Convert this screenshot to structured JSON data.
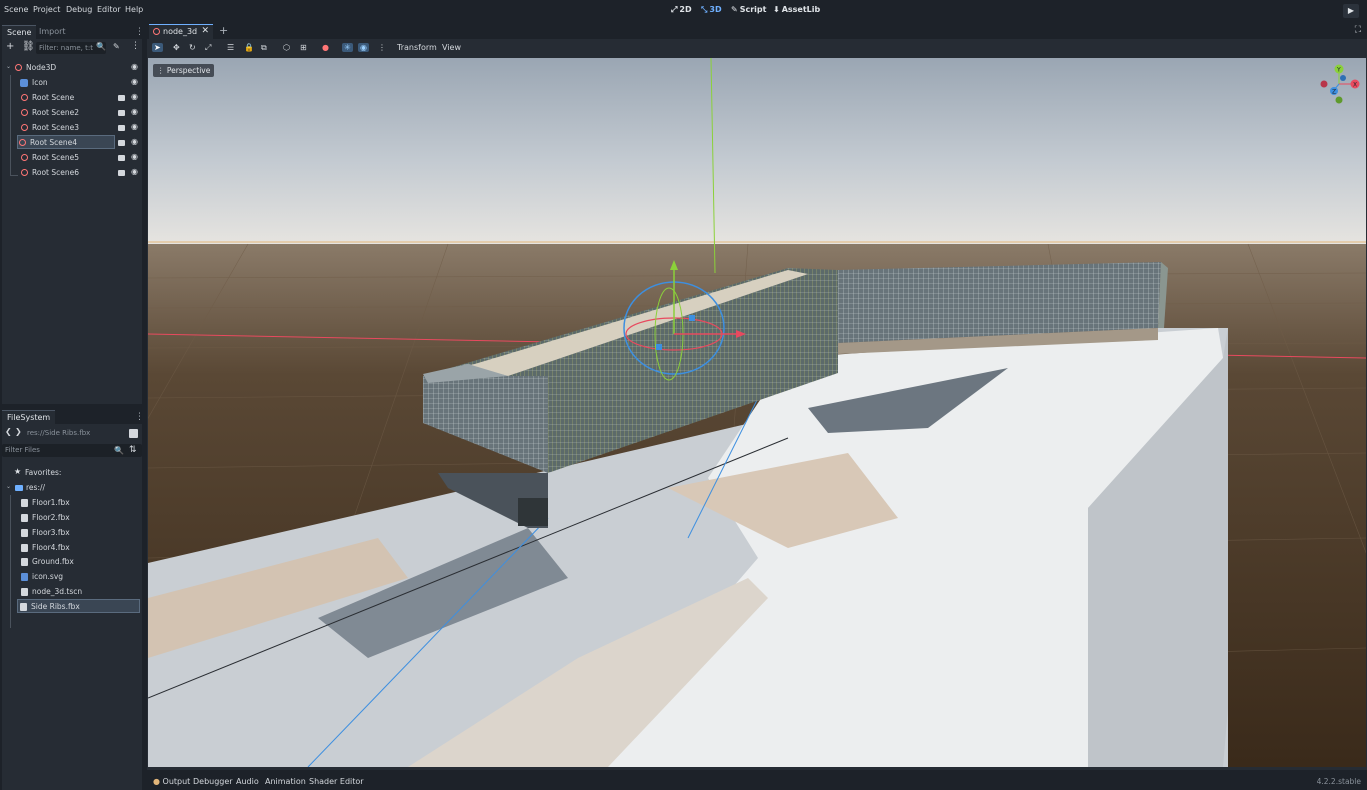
{
  "menu": [
    "Scene",
    "Project",
    "Debug",
    "Editor",
    "Help"
  ],
  "workspaces": [
    {
      "label": "2D",
      "icon": "⤢"
    },
    {
      "label": "3D",
      "icon": "⤡"
    },
    {
      "label": "Script",
      "icon": "✎"
    },
    {
      "label": "AssetLib",
      "icon": "⬇"
    }
  ],
  "scene_dock": {
    "tabs": [
      "Scene",
      "Import"
    ],
    "filter_placeholder": "Filter: name, t:t",
    "nodes": [
      {
        "label": "Node3D"
      },
      {
        "label": "Icon"
      },
      {
        "label": "Root Scene"
      },
      {
        "label": "Root Scene2"
      },
      {
        "label": "Root Scene3"
      },
      {
        "label": "Root Scene4"
      },
      {
        "label": "Root Scene5"
      },
      {
        "label": "Root Scene6"
      }
    ]
  },
  "filesystem": {
    "tab": "FileSystem",
    "path": "res://Side Ribs.fbx",
    "filter_placeholder": "Filter Files",
    "favorites": "Favorites:",
    "root": "res://",
    "files": [
      "Floor1.fbx",
      "Floor2.fbx",
      "Floor3.fbx",
      "Floor4.fbx",
      "Ground.fbx",
      "icon.svg",
      "node_3d.tscn",
      "Side Ribs.fbx"
    ]
  },
  "editor": {
    "scene_tab": "node_3d",
    "toolbar_menus": [
      "Transform",
      "View"
    ],
    "viewport_label": "Perspective"
  },
  "gizmo_axes": [
    "Y",
    "X",
    "Z"
  ],
  "bottom_tabs": [
    "Output",
    "Debugger",
    "Audio",
    "Animation",
    "Shader Editor"
  ],
  "version": "4.2.2.stable",
  "colors": {
    "accent": "#6fb0ff",
    "node_red": "#ff7676",
    "x_axis": "#e84a5f",
    "y_axis": "#8bd13a",
    "z_axis": "#3d8fe0"
  }
}
